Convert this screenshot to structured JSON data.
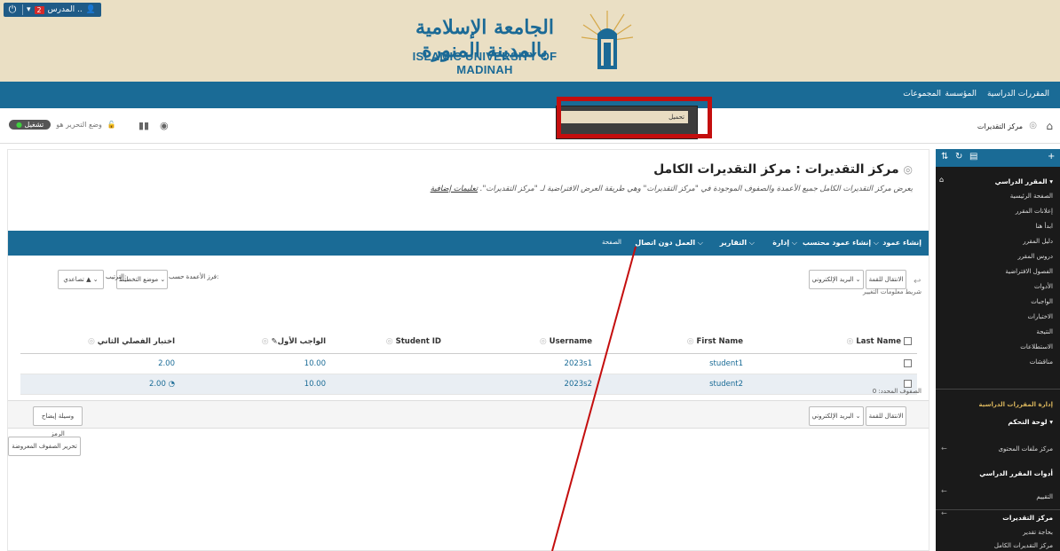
{
  "utility": {
    "power_icon": "power-icon",
    "notification_count": "2",
    "user_name": "المدرس .."
  },
  "logo": {
    "arabic": "الجامعة الإسلامية بالمدينة المنورة",
    "english": "ISLAMIC UNIVERSITY OF MADINAH"
  },
  "mainnav": {
    "courses": "المقررات الدراسية",
    "institution": "المؤسسة",
    "groups": "المجموعات"
  },
  "crumbbar": {
    "current": "مركز التقديرات",
    "edit_mode_label": "وضع التحرير هو",
    "edit_mode_state": "تشغيل"
  },
  "page": {
    "title": "مركز التقديرات : مركز التقديرات الكامل",
    "description": "يعرض مركز التقديرات الكامل جميع الأعمدة والصفوف الموجودة في \"مركز التقديرات\" وهي طريقة العرض الافتراضية لـ \"مركز التقديرات\". ",
    "more_link": "تعليمات إضافية"
  },
  "actionbar": {
    "create_column": "إنشاء عمود",
    "create_calc_column": "إنشاء عمود محتسب",
    "manage": "إدارة",
    "reports": "التقارير",
    "offline_work": "العمل دون اتصال",
    "page": "الصفحة"
  },
  "dropdown": {
    "item": "تحميل"
  },
  "controls": {
    "move_to_top": "الانتقال للقمة",
    "email": "البريد الإلكتروني",
    "sort_columns_by": "فرز الأعمدة حسب:",
    "sort_value": "موضع التخطيط",
    "order": "الترتيب:",
    "order_value": "تصاعدي",
    "filter_link": "شريط معلومات التغيير",
    "icon_legend": "وسيلة إيضاح الرمز",
    "edit_rows": "تحرير الصفوف المعروضة",
    "selected_rows": "الصفوف المحدد: 0"
  },
  "table": {
    "headers": [
      "Last Name",
      "First Name",
      "Username",
      "Student ID",
      "الواجب الأول",
      "اختبار الفصلي الثاني"
    ],
    "rows": [
      {
        "last": "",
        "first": "student1",
        "username": "2023s1",
        "student_id": "",
        "assignment": "10.00",
        "exam": "2.00"
      },
      {
        "last": "",
        "first": "student2",
        "username": "2023s2",
        "student_id": "",
        "assignment": "10.00",
        "exam": "2.00"
      }
    ]
  },
  "sidebar": {
    "course_title": "المقرر الدراسي",
    "items": [
      "الصفحة الرئيسية",
      "إعلانات المقرر",
      "ابدأ هنا",
      "دليل المقرر",
      "دروس المقرر",
      "الفصول الافتراضية",
      "الأدوات",
      "الواجبات",
      "الاختبارات",
      "النتيجة",
      "الاستطلاعات",
      "مناقشات"
    ],
    "manage_title": "إدارة المقررات الدراسية",
    "control_panel": "لوحة التحكم",
    "content_center": "مركز ملفات المحتوى",
    "course_tools": "أدوات المقرر الدراسي",
    "evaluation": "التقييم",
    "grade_center": "مركز التقديرات",
    "needs_grading": "بحاجة تقدير",
    "full_grade_center": "مركز التقديرات الكامل"
  }
}
